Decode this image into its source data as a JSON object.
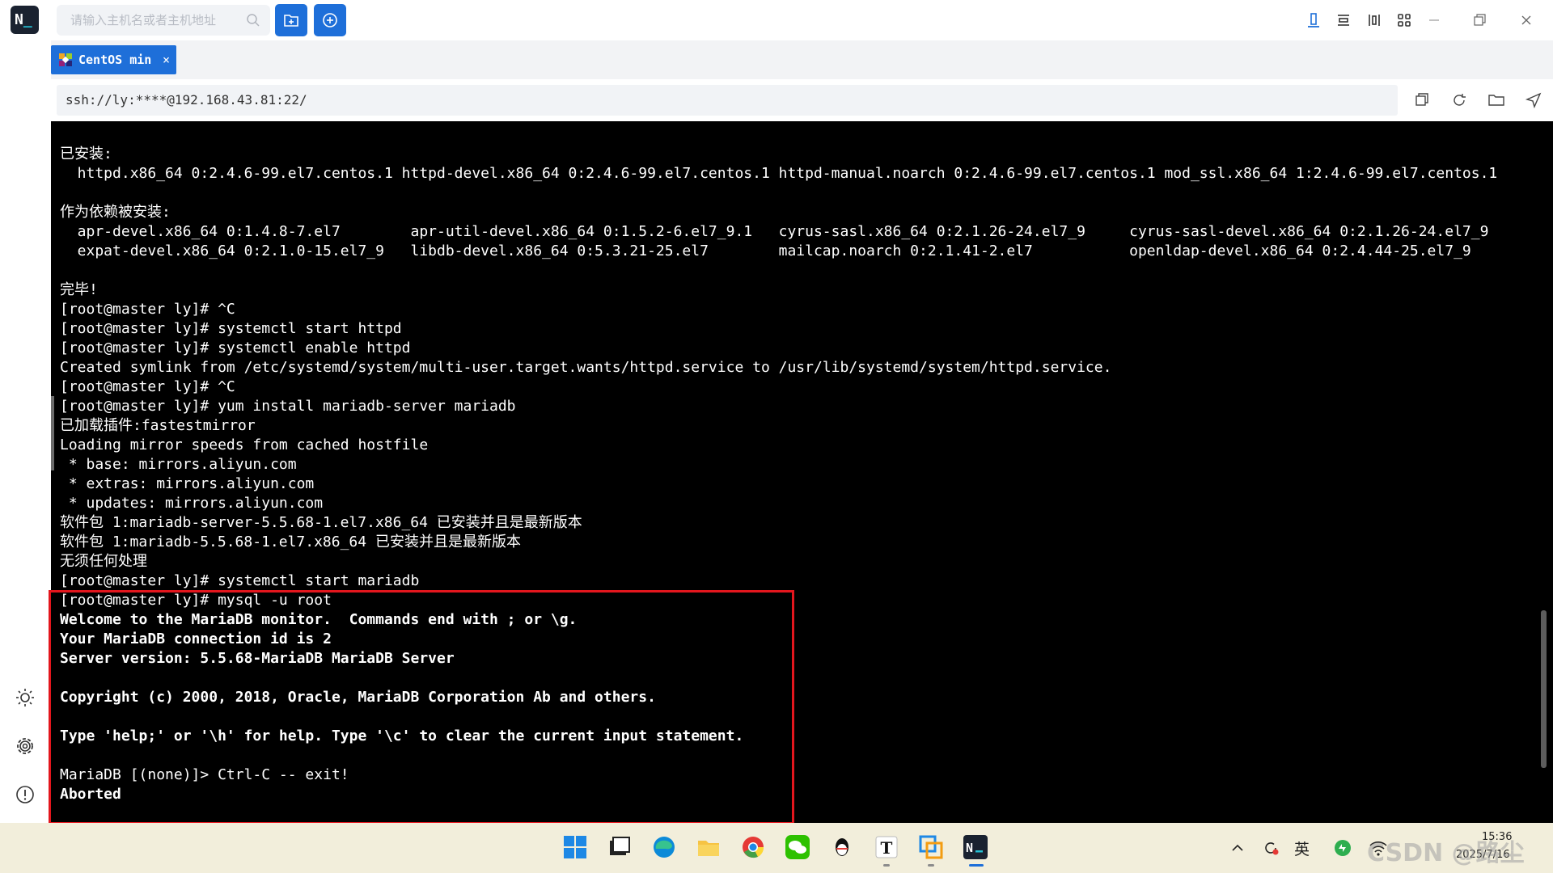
{
  "app": {
    "logo_text": "N",
    "search_placeholder": "请输入主机名或者主机地址",
    "icons": [
      "search-icon",
      "new-folder-icon",
      "add-session-icon",
      "layout-single-icon",
      "layout-rows-icon",
      "layout-columns-icon",
      "layout-grid-icon",
      "minimize-icon",
      "restore-icon",
      "close-icon"
    ]
  },
  "tab": {
    "label": "CentOS min",
    "close": "×"
  },
  "address": {
    "value": "ssh://ly:****@192.168.43.81:22/"
  },
  "terminal": {
    "lines": [
      "已安装:",
      "  httpd.x86_64 0:2.4.6-99.el7.centos.1 httpd-devel.x86_64 0:2.4.6-99.el7.centos.1 httpd-manual.noarch 0:2.4.6-99.el7.centos.1 mod_ssl.x86_64 1:2.4.6-99.el7.centos.1",
      "",
      "作为依赖被安装:",
      "  apr-devel.x86_64 0:1.4.8-7.el7        apr-util-devel.x86_64 0:1.5.2-6.el7_9.1   cyrus-sasl.x86_64 0:2.1.26-24.el7_9     cyrus-sasl-devel.x86_64 0:2.1.26-24.el7_9",
      "  expat-devel.x86_64 0:2.1.0-15.el7_9   libdb-devel.x86_64 0:5.3.21-25.el7        mailcap.noarch 0:2.1.41-2.el7           openldap-devel.x86_64 0:2.4.44-25.el7_9",
      "",
      "完毕!",
      "[root@master ly]# ^C",
      "[root@master ly]# systemctl start httpd",
      "[root@master ly]# systemctl enable httpd",
      "Created symlink from /etc/systemd/system/multi-user.target.wants/httpd.service to /usr/lib/systemd/system/httpd.service.",
      "[root@master ly]# ^C",
      "[root@master ly]# yum install mariadb-server mariadb",
      "已加载插件:fastestmirror",
      "Loading mirror speeds from cached hostfile",
      " * base: mirrors.aliyun.com",
      " * extras: mirrors.aliyun.com",
      " * updates: mirrors.aliyun.com",
      "软件包 1:mariadb-server-5.5.68-1.el7.x86_64 已安装并且是最新版本",
      "软件包 1:mariadb-5.5.68-1.el7.x86_64 已安装并且是最新版本",
      "无须任何处理",
      "[root@master ly]# systemctl start mariadb",
      "[root@master ly]# mysql -u root",
      "Welcome to the MariaDB monitor.  Commands end with ; or \\g.",
      "Your MariaDB connection id is 2",
      "Server version: 5.5.68-MariaDB MariaDB Server",
      "",
      "Copyright (c) 2000, 2018, Oracle, MariaDB Corporation Ab and others.",
      "",
      "Type 'help;' or '\\h' for help. Type '\\c' to clear the current input statement.",
      "",
      "MariaDB [(none)]> Ctrl-C -- exit!",
      "Aborted"
    ]
  },
  "colors": {
    "accent": "#1e6fd9",
    "terminal_bg": "#000000",
    "terminal_fg": "#ffffff",
    "highlight": "#e3161d",
    "taskbar_bg": "#f2eedb"
  },
  "taskbar": {
    "apps": [
      "windows-start-icon",
      "file-explorer-window-icon",
      "edge-icon",
      "folder-icon",
      "chrome-icon",
      "wechat-icon",
      "qq-icon",
      "typora-icon",
      "network-app-icon",
      "terminal-app-icon"
    ],
    "tray_lang": "英",
    "time": "15:36",
    "date": "2025/7/16",
    "watermark": "CSDN @路尘"
  }
}
